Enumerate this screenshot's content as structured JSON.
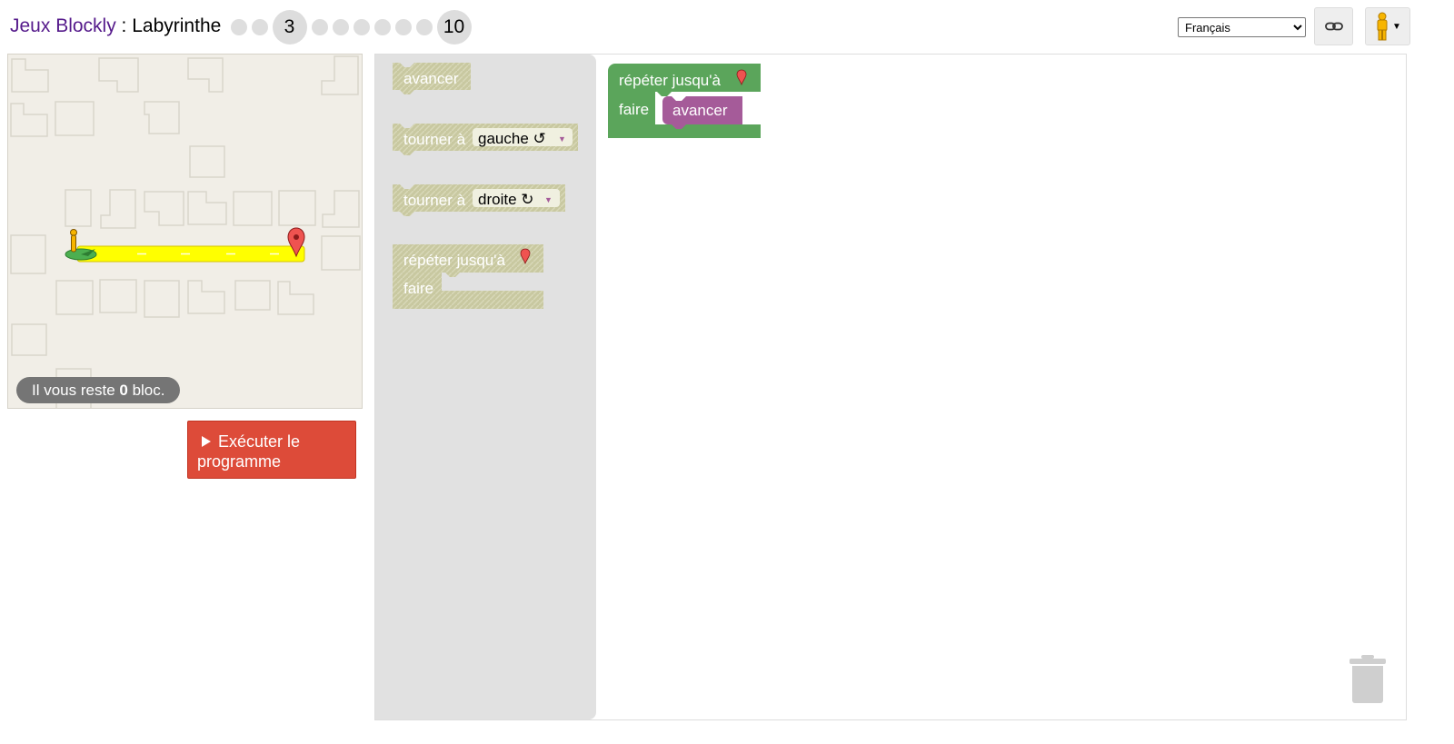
{
  "header": {
    "app_name": "Jeux Blockly",
    "separator": " : ",
    "game_name": "Labyrinthe",
    "current_level": "3",
    "last_level": "10",
    "link_icon": "link-icon",
    "pegman_icon": "pegman-icon"
  },
  "language": {
    "selected": "Français",
    "options": [
      "Français"
    ]
  },
  "maze": {
    "capacity_prefix": "Il vous reste ",
    "capacity_count": "0",
    "capacity_suffix": " bloc.",
    "start_icon": "pegman-icon",
    "goal_icon": "map-marker-icon"
  },
  "run_button": {
    "icon": "play-icon",
    "label": "Exécuter le programme"
  },
  "toolbox": {
    "avancer": "avancer",
    "tourner_a": "tourner à",
    "gauche": "gauche ↺",
    "droite": "droite ↻",
    "repeter": "répéter jusqu'à",
    "faire": "faire",
    "dropdown_arrow": "▼"
  },
  "program": {
    "repeter": "répéter jusqu'à",
    "faire": "faire",
    "avancer": "avancer"
  },
  "colors": {
    "movement_block": "#a55b99",
    "loop_block": "#5ba55b",
    "disabled_block": "#c8c8a0",
    "run_button": "#dd4b39",
    "path": "#ffff00",
    "maze_bg": "#f1eee7"
  },
  "workspace": {
    "trash_icon": "trash-icon"
  }
}
